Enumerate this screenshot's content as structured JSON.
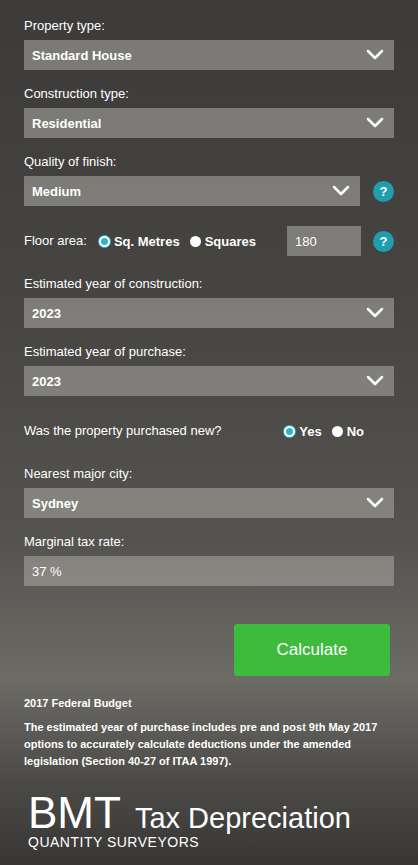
{
  "fields": [
    {
      "kind": "select",
      "label": "Property type:",
      "value": "Standard House"
    },
    {
      "kind": "select",
      "label": "Construction type:",
      "value": "Residential"
    },
    {
      "kind": "select",
      "label": "Quality of finish:",
      "value": "Medium",
      "help": "?"
    },
    {
      "kind": "area",
      "label": "Floor area:",
      "options": [
        {
          "label": "Sq. Metres",
          "selected": true
        },
        {
          "label": "Squares",
          "selected": false
        }
      ],
      "value": "180",
      "help": "?"
    },
    {
      "kind": "select",
      "label": "Estimated year of construction:",
      "value": "2023"
    },
    {
      "kind": "select",
      "label": "Estimated year of purchase:",
      "value": "2023"
    },
    {
      "kind": "radio",
      "label": "Was the property purchased new?",
      "options": [
        {
          "label": "Yes",
          "selected": true
        },
        {
          "label": "No",
          "selected": false
        }
      ]
    },
    {
      "kind": "select",
      "label": "Nearest major city:",
      "value": "Sydney"
    },
    {
      "kind": "input",
      "label": "Marginal tax rate:",
      "value": "37 %"
    }
  ],
  "button": "Calculate",
  "note": {
    "title": "2017 Federal Budget",
    "body": "The estimated year of purchase includes pre and post 9th May 2017 options to accurately calculate deductions under the amended legislation (Section 40-27 of ITAA 1997)."
  },
  "logo": {
    "brand": "BMT",
    "name": "Tax Depreciation",
    "tagline": "QUANTITY SURVEYORS"
  }
}
